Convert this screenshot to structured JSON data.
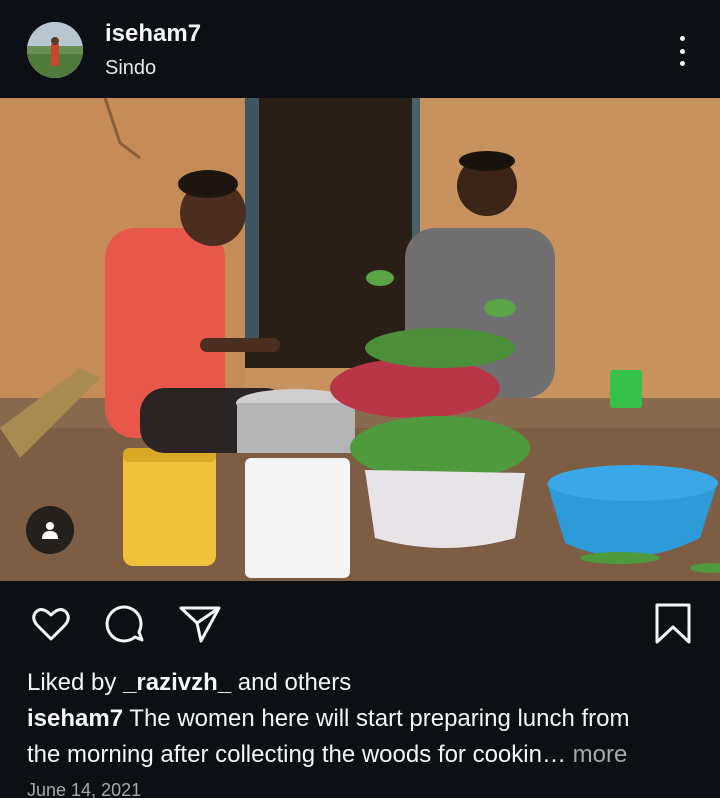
{
  "post": {
    "username": "iseham7",
    "location": "Sindo"
  },
  "icons": {
    "avatar": "profile-avatar",
    "more": "more-vertical-icon",
    "tag": "person-tag-icon",
    "like": "heart-icon",
    "comment": "comment-bubble-icon",
    "share": "paper-plane-icon",
    "save": "bookmark-icon"
  },
  "likes": {
    "prefix": "Liked by",
    "user": "_razivzh_",
    "suffix": "and others"
  },
  "caption": {
    "username": "iseham7",
    "line1": "The women here will start preparing lunch from",
    "line2": "the morning after collecting the woods for cookin…",
    "more": "more"
  },
  "date": "June 14, 2021",
  "colors": {
    "background": "#0c1014",
    "text": "#f5f5f5",
    "muted": "#a8a8a8"
  }
}
